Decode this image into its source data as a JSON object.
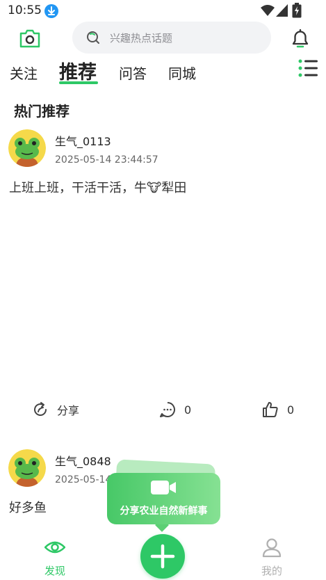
{
  "status_bar": {
    "time": "10:55"
  },
  "search": {
    "placeholder": "兴趣热点话题"
  },
  "tabs": [
    {
      "label": "关注"
    },
    {
      "label": "推荐"
    },
    {
      "label": "问答"
    },
    {
      "label": "同城"
    }
  ],
  "section_title": "热门推荐",
  "posts": [
    {
      "username": "生气_0113",
      "time": "2025-05-14 23:44:57",
      "content": "上班上班，干活干活，牛🐮犁田"
    },
    {
      "username": "生气_0848",
      "time": "2025-05-14",
      "content": "好多鱼"
    }
  ],
  "actions": {
    "share_label": "分享",
    "comment_count": "0",
    "like_count": "0"
  },
  "promo": {
    "text": "分享农业自然新鲜事"
  },
  "nav": {
    "discover_label": "发现",
    "mine_label": "我的"
  },
  "colors": {
    "accent": "#2ec866",
    "text": "#222222",
    "muted": "#666666"
  }
}
